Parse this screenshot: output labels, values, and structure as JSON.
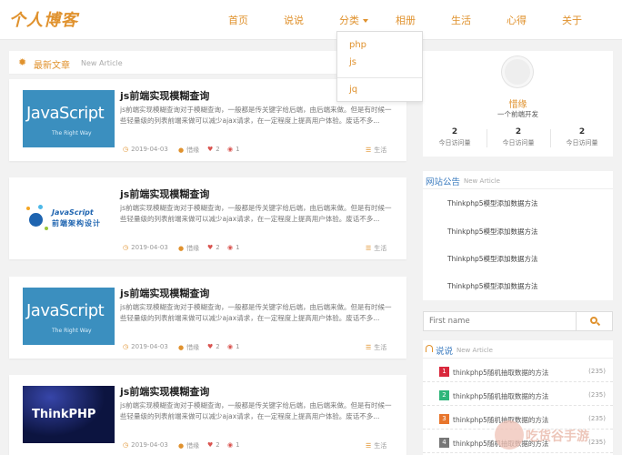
{
  "site": {
    "logo_text": "个人博客"
  },
  "nav": {
    "items": [
      "首页",
      "说说",
      "分类",
      "相册",
      "生活",
      "心得",
      "关于"
    ],
    "dropdown": [
      "php",
      "js",
      "jq"
    ]
  },
  "latest": {
    "title": "最新文章",
    "subtitle": "New Article"
  },
  "articles": [
    {
      "title": "js前端实现模糊查询",
      "desc": "js前端实现模糊查询对于模糊查询，一般都是传关键字给后端，由后端来做。但是有时候一些轻量级的列表前端来做可以减少ajax请求，在一定程度上提高用户体验。废话不多...",
      "thumb_main": "JavaScript",
      "thumb_sub": "The Right Way",
      "date": "2019-04-03",
      "author": "惜缘",
      "likes": "2",
      "views": "1",
      "category": "生活"
    },
    {
      "title": "js前端实现模糊查询",
      "desc": "js前端实现模糊查询对于模糊查询，一般都是传关键字给后端，由后端来做。但是有时候一些轻量级的列表前端来做可以减少ajax请求，在一定程度上提高用户体验。废话不多...",
      "thumb_main": "JavaScript",
      "thumb_sub": "前端架构设计",
      "date": "2019-04-03",
      "author": "惜缘",
      "likes": "2",
      "views": "1",
      "category": "生活"
    },
    {
      "title": "js前端实现模糊查询",
      "desc": "js前端实现模糊查询对于模糊查询，一般都是传关键字给后端，由后端来做。但是有时候一些轻量级的列表前端来做可以减少ajax请求，在一定程度上提高用户体验。废话不多...",
      "thumb_main": "JavaScript",
      "thumb_sub": "The Right Way",
      "date": "2019-04-03",
      "author": "惜缘",
      "likes": "2",
      "views": "1",
      "category": "生活"
    },
    {
      "title": "js前端实现模糊查询",
      "desc": "js前端实现模糊查询对于模糊查询，一般都是传关键字给后端，由后端来做。但是有时候一些轻量级的列表前端来做可以减少ajax请求，在一定程度上提高用户体验。废话不多...",
      "thumb_main": "ThinkPHP",
      "thumb_sub": "",
      "date": "2019-04-03",
      "author": "惜缘",
      "likes": "2",
      "views": "1",
      "category": "生活"
    }
  ],
  "profile": {
    "name": "惜缘",
    "tagline": "一个前端开发",
    "stats": [
      {
        "value": "2",
        "label": "今日访问量"
      },
      {
        "value": "2",
        "label": "今日访问量"
      },
      {
        "value": "2",
        "label": "今日访问量"
      }
    ]
  },
  "notice": {
    "title": "网站公告",
    "subtitle": "New Article",
    "items": [
      "Thinkphp5模型添加数据方法",
      "Thinkphp5模型添加数据方法",
      "Thinkphp5模型添加数据方法",
      "Thinkphp5模型添加数据方法"
    ]
  },
  "search": {
    "placeholder": "First name"
  },
  "talk": {
    "title": "说说",
    "subtitle": "New Article",
    "items": [
      {
        "rank": "1",
        "text": "thinkphp5随机抽取数据的方法",
        "count": "(235)",
        "color": "#d9283c"
      },
      {
        "rank": "2",
        "text": "thinkphp5随机抽取数据的方法",
        "count": "(235)",
        "color": "#2fb67a"
      },
      {
        "rank": "3",
        "text": "thinkphp5随机抽取数据的方法",
        "count": "(235)",
        "color": "#e8762d"
      },
      {
        "rank": "4",
        "text": "thinkphp5随机抽取数据的方法",
        "count": "(235)",
        "color": "#777777"
      }
    ]
  },
  "watermark": {
    "text": "吃货谷手游"
  },
  "colors": {
    "accent": "#e0922e",
    "link_blue": "#3b7bbf",
    "bg": "#f2f2f2"
  }
}
